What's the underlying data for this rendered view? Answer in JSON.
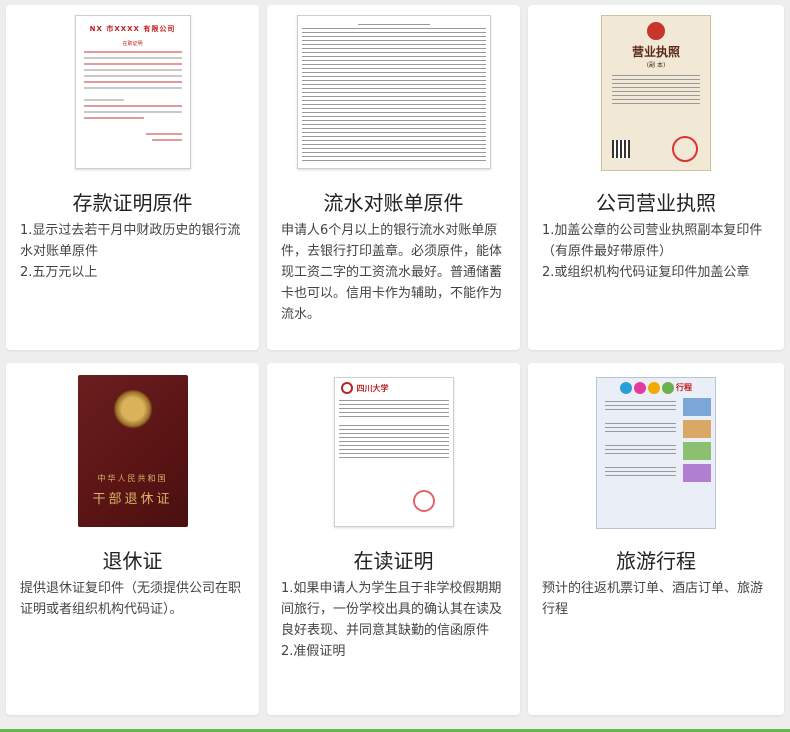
{
  "cards": [
    {
      "title": "存款证明原件",
      "desc": [
        "1.显示过去若干月中财政历史的银行流水对账单原件",
        "2.五万元以上"
      ],
      "thumb": {
        "header": "NX 市XXXX 有限公司",
        "subheader": "在职证明"
      }
    },
    {
      "title": "流水对账单原件",
      "desc": [
        "申请人6个月以上的银行流水对账单原件，去银行打印盖章。必须原件，能体现工资二字的工资流水最好。普通储蓄卡也可以。信用卡作为辅助，不能作为流水。"
      ],
      "thumb": {}
    },
    {
      "title": "公司营业执照",
      "desc": [
        "1.加盖公章的公司营业执照副本复印件（有原件最好带原件）",
        "2.或组织机构代码证复印件加盖公章"
      ],
      "thumb": {
        "header": "营业执照",
        "subheader": "(副 本)"
      }
    },
    {
      "title": "退休证",
      "desc": [
        "提供退休证复印件（无须提供公司在职证明或者组织机构代码证）。"
      ],
      "thumb": {
        "line1": "中华人民共和国",
        "line2": "干部退休证"
      }
    },
    {
      "title": "在读证明",
      "desc": [
        "1.如果申请人为学生且于非学校假期期间旅行，一份学校出具的确认其在读及良好表现、并同意其缺勤的信函原件",
        "2.准假证明"
      ],
      "thumb": {
        "header": "四川大学"
      }
    },
    {
      "title": "旅游行程",
      "desc": [
        "预计的往返机票订单、酒店订单、旅游行程"
      ],
      "thumb": {
        "header": "行程"
      }
    }
  ],
  "colors": {
    "accent_green": "#67b84a",
    "seal_red": "#c21b1b"
  }
}
